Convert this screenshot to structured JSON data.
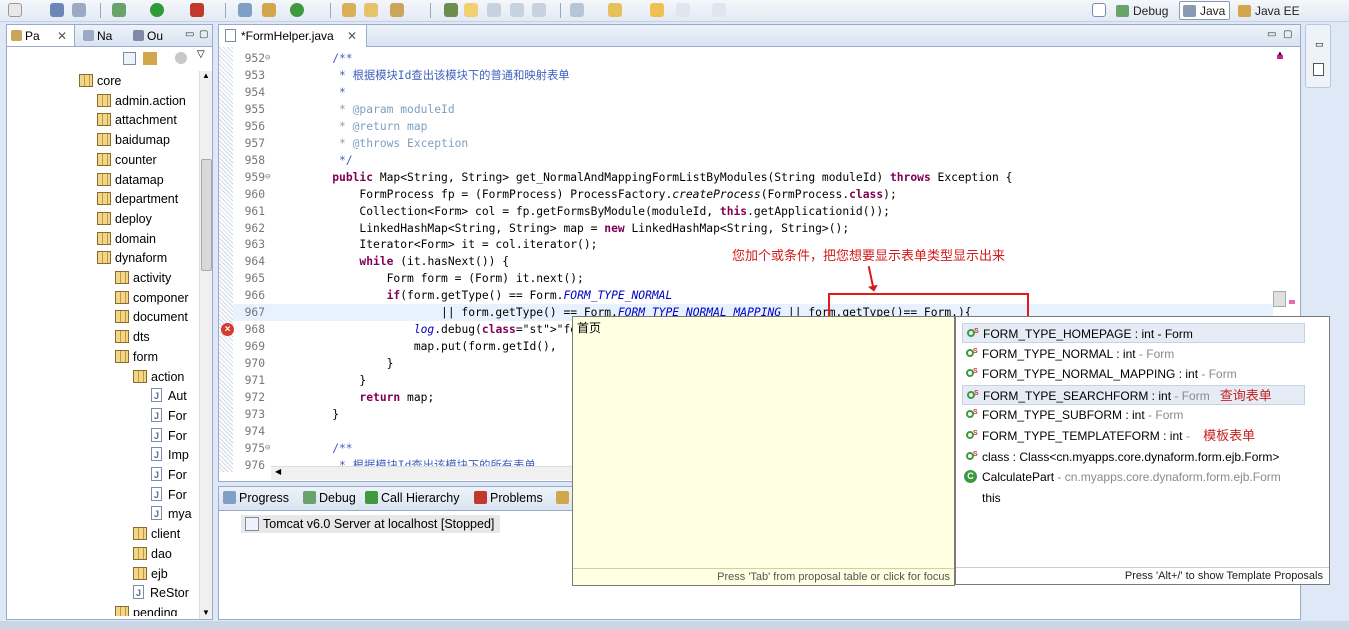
{
  "toolbar": {
    "perspectives": [
      {
        "label": "Debug",
        "selected": false
      },
      {
        "label": "Java",
        "selected": true
      },
      {
        "label": "Java EE",
        "selected": false
      }
    ]
  },
  "left_panel": {
    "tabs": [
      "Pa",
      "Na",
      "Ou"
    ],
    "tree": [
      {
        "label": "core",
        "indent": 0,
        "kind": "package"
      },
      {
        "label": "admin.action",
        "indent": 1,
        "kind": "package"
      },
      {
        "label": "attachment",
        "indent": 1,
        "kind": "package"
      },
      {
        "label": "baidumap",
        "indent": 1,
        "kind": "package"
      },
      {
        "label": "counter",
        "indent": 1,
        "kind": "package"
      },
      {
        "label": "datamap",
        "indent": 1,
        "kind": "package"
      },
      {
        "label": "department",
        "indent": 1,
        "kind": "package"
      },
      {
        "label": "deploy",
        "indent": 1,
        "kind": "package"
      },
      {
        "label": "domain",
        "indent": 1,
        "kind": "package"
      },
      {
        "label": "dynaform",
        "indent": 1,
        "kind": "package"
      },
      {
        "label": "activity",
        "indent": 2,
        "kind": "package"
      },
      {
        "label": "componer",
        "indent": 2,
        "kind": "package"
      },
      {
        "label": "document",
        "indent": 2,
        "kind": "package"
      },
      {
        "label": "dts",
        "indent": 2,
        "kind": "package"
      },
      {
        "label": "form",
        "indent": 2,
        "kind": "package"
      },
      {
        "label": "action",
        "indent": 3,
        "kind": "package"
      },
      {
        "label": "Aut",
        "indent": 4,
        "kind": "file"
      },
      {
        "label": "For",
        "indent": 4,
        "kind": "file"
      },
      {
        "label": "For",
        "indent": 4,
        "kind": "file"
      },
      {
        "label": "Imp",
        "indent": 4,
        "kind": "file"
      },
      {
        "label": "For",
        "indent": 4,
        "kind": "file"
      },
      {
        "label": "For",
        "indent": 4,
        "kind": "file"
      },
      {
        "label": "mya",
        "indent": 4,
        "kind": "file"
      },
      {
        "label": "client",
        "indent": 3,
        "kind": "package"
      },
      {
        "label": "dao",
        "indent": 3,
        "kind": "package"
      },
      {
        "label": "ejb",
        "indent": 3,
        "kind": "package"
      },
      {
        "label": "ReStor",
        "indent": 3,
        "kind": "file"
      },
      {
        "label": "pending",
        "indent": 2,
        "kind": "package"
      }
    ]
  },
  "editor": {
    "tab_label": "*FormHelper.java",
    "lines": [
      {
        "num": "952",
        "text": "    /**",
        "cls": "cm",
        "fold": true
      },
      {
        "num": "953",
        "text": "     * 根据模块Id查出该模块下的普通和映射表单",
        "cls": "cm"
      },
      {
        "num": "954",
        "text": "     *",
        "cls": "cm"
      },
      {
        "num": "955",
        "text": "     * @param moduleId",
        "cls": "cmt"
      },
      {
        "num": "956",
        "text": "     * @return map",
        "cls": "cmt"
      },
      {
        "num": "957",
        "text": "     * @throws Exception",
        "cls": "cmt"
      },
      {
        "num": "958",
        "text": "     */",
        "cls": "cm"
      },
      {
        "num": "959",
        "text": "    public Map<String, String> get_NormalAndMappingFormListByModules(String moduleId) throws Exception {",
        "cls": "",
        "fold": true
      },
      {
        "num": "960",
        "text": "        FormProcess fp = (FormProcess) ProcessFactory.createProcess(FormProcess.class);",
        "cls": ""
      },
      {
        "num": "961",
        "text": "        Collection<Form> col = fp.getFormsByModule(moduleId, this.getApplicationid());",
        "cls": ""
      },
      {
        "num": "962",
        "text": "        LinkedHashMap<String, String> map = new LinkedHashMap<String, String>();",
        "cls": ""
      },
      {
        "num": "963",
        "text": "        Iterator<Form> it = col.iterator();",
        "cls": ""
      },
      {
        "num": "964",
        "text": "        while (it.hasNext()) {",
        "cls": ""
      },
      {
        "num": "965",
        "text": "            Form form = (Form) it.next();",
        "cls": ""
      },
      {
        "num": "966",
        "text": "            if(form.getType() == Form.FORM_TYPE_NORMAL",
        "cls": ""
      },
      {
        "num": "967",
        "text": "                    || form.getType() == Form.FORM_TYPE_NORMAL_MAPPING || form.getType()== Form.){",
        "cls": "",
        "error": true,
        "highlight": true
      },
      {
        "num": "968",
        "text": "                log.debug(\"formname-->",
        "cls": ""
      },
      {
        "num": "969",
        "text": "                map.put(form.getId(),",
        "cls": ""
      },
      {
        "num": "970",
        "text": "            }",
        "cls": ""
      },
      {
        "num": "971",
        "text": "        }",
        "cls": ""
      },
      {
        "num": "972",
        "text": "        return map;",
        "cls": ""
      },
      {
        "num": "973",
        "text": "    }",
        "cls": ""
      },
      {
        "num": "974",
        "text": "",
        "cls": ""
      },
      {
        "num": "975",
        "text": "    /**",
        "cls": "cm",
        "fold": true
      },
      {
        "num": "976",
        "text": "     * 根据模块Id查出该模块下的所有表单,",
        "cls": "cm"
      }
    ]
  },
  "annotation": {
    "note": "您加个或条件，把您想要显示表单类型显示出来"
  },
  "bottom_panel": {
    "tabs": [
      "Progress",
      "Debug",
      "Call Hierarchy",
      "Problems"
    ],
    "server_row": "Tomcat v6.0 Server at localhost  [Stopped]"
  },
  "info_popup": {
    "text": "首页",
    "footer": "Press 'Tab' from proposal table or click for focus"
  },
  "proposals": {
    "items": [
      {
        "main": "FORM_TYPE_HOMEPAGE : int",
        "sep": " - ",
        "owner": "Form",
        "owner_dark": true,
        "note": "",
        "selected": true,
        "icon": "field"
      },
      {
        "main": "FORM_TYPE_NORMAL : int",
        "sep": " - ",
        "owner": "Form",
        "note": "",
        "icon": "field"
      },
      {
        "main": "FORM_TYPE_NORMAL_MAPPING : int",
        "sep": " - ",
        "owner": "Form",
        "note": "",
        "icon": "field"
      },
      {
        "main": "FORM_TYPE_SEARCHFORM : int",
        "sep": " - ",
        "owner": "Form",
        "note": "查询表单",
        "highlight": true,
        "icon": "field"
      },
      {
        "main": "FORM_TYPE_SUBFORM : int",
        "sep": " - ",
        "owner": "Form",
        "note": "",
        "icon": "field"
      },
      {
        "main": "FORM_TYPE_TEMPLATEFORM : int",
        "sep": " - ",
        "owner": "",
        "note": "模板表单",
        "icon": "field"
      },
      {
        "main": "class : Class<cn.myapps.core.dynaform.form.ejb.Form>",
        "sep": "",
        "owner": "",
        "note": "",
        "icon": "field"
      },
      {
        "main": "CalculatePart",
        "sep": " - ",
        "owner": "cn.myapps.core.dynaform.form.ejb.Form",
        "note": "",
        "icon": "class"
      },
      {
        "main": "this",
        "sep": "",
        "owner": "",
        "note": "",
        "icon": "none"
      }
    ],
    "footer": "Press 'Alt+/' to show Template Proposals"
  }
}
